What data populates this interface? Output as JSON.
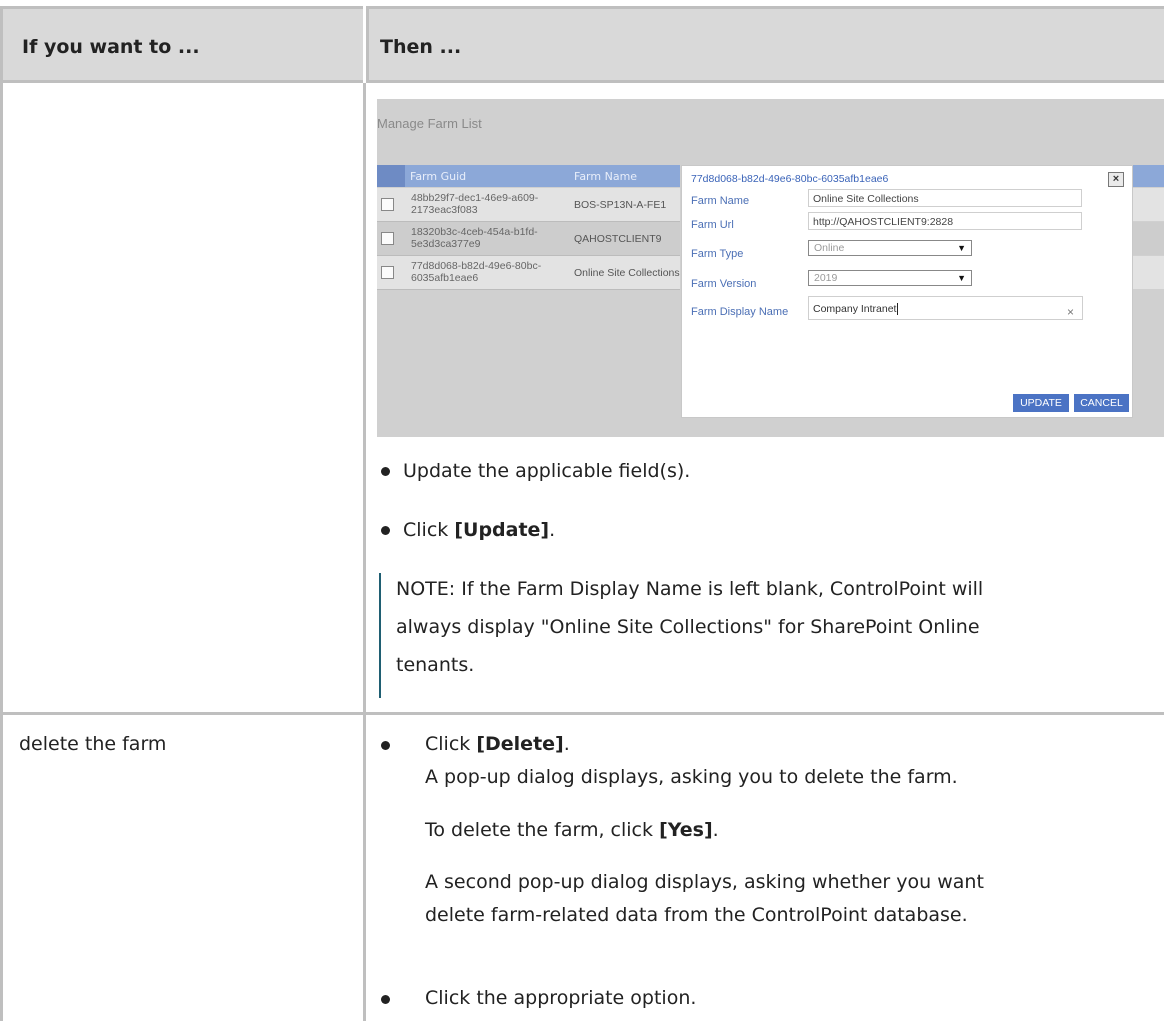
{
  "table": {
    "header": {
      "col1": "If you want to ...",
      "col2": "Then ..."
    },
    "row1": {
      "screenshot": {
        "title": "Manage Farm List",
        "grid_columns": [
          "Farm Guid",
          "Farm Name"
        ],
        "grid_rows": [
          {
            "guid": "48bb29f7-dec1-46e9-a609-2173eac3f083",
            "name": "BOS-SP13N-A-FE1"
          },
          {
            "guid": "18320b3c-4ceb-454a-b1fd-5e3d3ca377e9",
            "name": "QAHOSTCLIENT9"
          },
          {
            "guid": "77d8d068-b82d-49e6-80bc-6035afb1eae6",
            "name": "Online Site Collections"
          }
        ],
        "dialog": {
          "close_glyph": "×",
          "guid": "77d8d068-b82d-49e6-80bc-6035afb1eae6",
          "farm_name_label": "Farm Name",
          "farm_name_value": "Online Site Collections",
          "farm_url_label": "Farm Url",
          "farm_url_value": "http://QAHOSTCLIENT9:2828",
          "farm_type_label": "Farm Type",
          "farm_type_value": "Online",
          "farm_version_label": "Farm Version",
          "farm_version_value": "2019",
          "farm_display_name_label": "Farm Display Name",
          "farm_display_name_value": "Company Intranet",
          "clear_glyph": "×",
          "update_label": "UPDATE",
          "cancel_label": "CANCEL"
        }
      },
      "bullet1": "Update the applicable field(s).",
      "bullet2_pre": "Click ",
      "bullet2_bold": "[Update]",
      "bullet2_post": ".",
      "note_line1": "NOTE:  If the Farm Display Name is left blank, ControlPoint will",
      "note_line2": "always display \"Online Site Collections\" for SharePoint Online",
      "note_line3": "tenants."
    },
    "row2": {
      "label": "delete the farm",
      "step1_pre": "Click ",
      "step1_bold": "[Delete]",
      "step1_post": ".",
      "step1_line2": "A pop-up dialog displays, asking you to delete the farm.",
      "para2_pre": "To delete the farm, click ",
      "para2_bold": "[Yes]",
      "para2_post": ".",
      "para3_line1": "A second pop-up dialog displays, asking whether you want",
      "para3_line2": "delete farm-related data from the ControlPoint database.",
      "step2": "Click the appropriate option."
    }
  }
}
